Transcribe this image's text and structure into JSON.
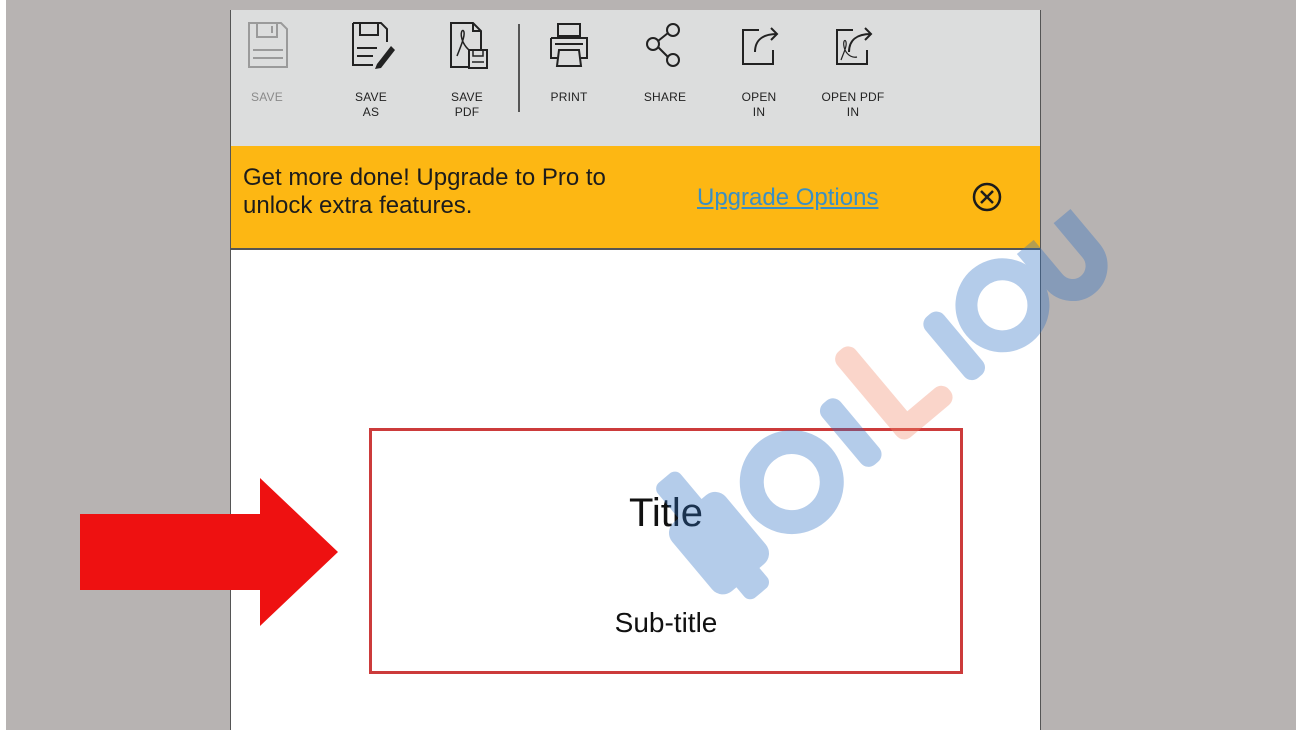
{
  "toolbar": {
    "items": [
      {
        "label": "SAVE",
        "icon": "floppy-disk-icon",
        "enabled": false
      },
      {
        "label": "SAVE\nAS",
        "icon": "save-as-icon",
        "enabled": true
      },
      {
        "label": "SAVE\nPDF",
        "icon": "save-pdf-icon",
        "enabled": true
      },
      {
        "label": "PRINT",
        "icon": "printer-icon",
        "enabled": true
      },
      {
        "label": "SHARE",
        "icon": "share-icon",
        "enabled": true
      },
      {
        "label": "OPEN\nIN",
        "icon": "open-in-icon",
        "enabled": true
      },
      {
        "label": "OPEN PDF\nIN",
        "icon": "open-pdf-in-icon",
        "enabled": true
      }
    ]
  },
  "banner": {
    "message": "Get more done! Upgrade to Pro to unlock extra features.",
    "link": "Upgrade Options",
    "close_icon": "close-circle-icon",
    "background": "#fdb713",
    "link_color": "#3a8fc4"
  },
  "slide": {
    "title": "Title",
    "subtitle": "Sub-title",
    "border_color": "#cc3b3b"
  },
  "annotation": {
    "icon": "red-arrow-right-icon",
    "color": "#ee1111"
  },
  "watermark": {
    "text": "TaiLieu.com"
  }
}
